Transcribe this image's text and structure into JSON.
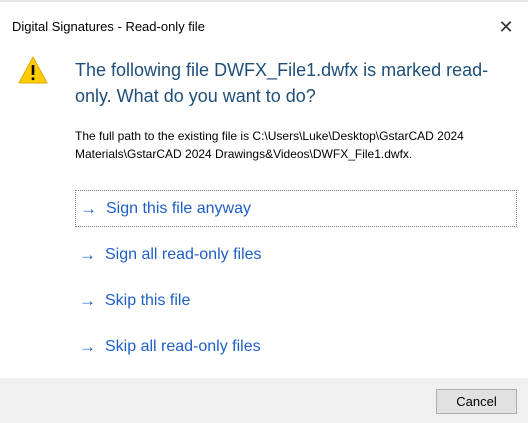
{
  "window": {
    "title": "Digital Signatures - Read-only file",
    "close_glyph": "✕"
  },
  "message": {
    "icon": "warning-icon",
    "heading": "The following file DWFX_File1.dwfx is marked read-only. What do you want to do?",
    "path_text": "The full path to the existing file is C:\\Users\\Luke\\Desktop\\GstarCAD 2024 Materials\\GstarCAD 2024 Drawings&Videos\\DWFX_File1.dwfx."
  },
  "options": [
    {
      "arrow": "→",
      "label": "Sign this file anyway"
    },
    {
      "arrow": "→",
      "label": "Sign all read-only files"
    },
    {
      "arrow": "→",
      "label": "Skip this file"
    },
    {
      "arrow": "→",
      "label": "Skip all read-only files"
    }
  ],
  "footer": {
    "cancel_label": "Cancel"
  },
  "colors": {
    "heading": "#1e4e79",
    "link": "#1e5fc8",
    "warning_fill": "#ffcc00",
    "footer_bg": "#f0f0f0"
  }
}
